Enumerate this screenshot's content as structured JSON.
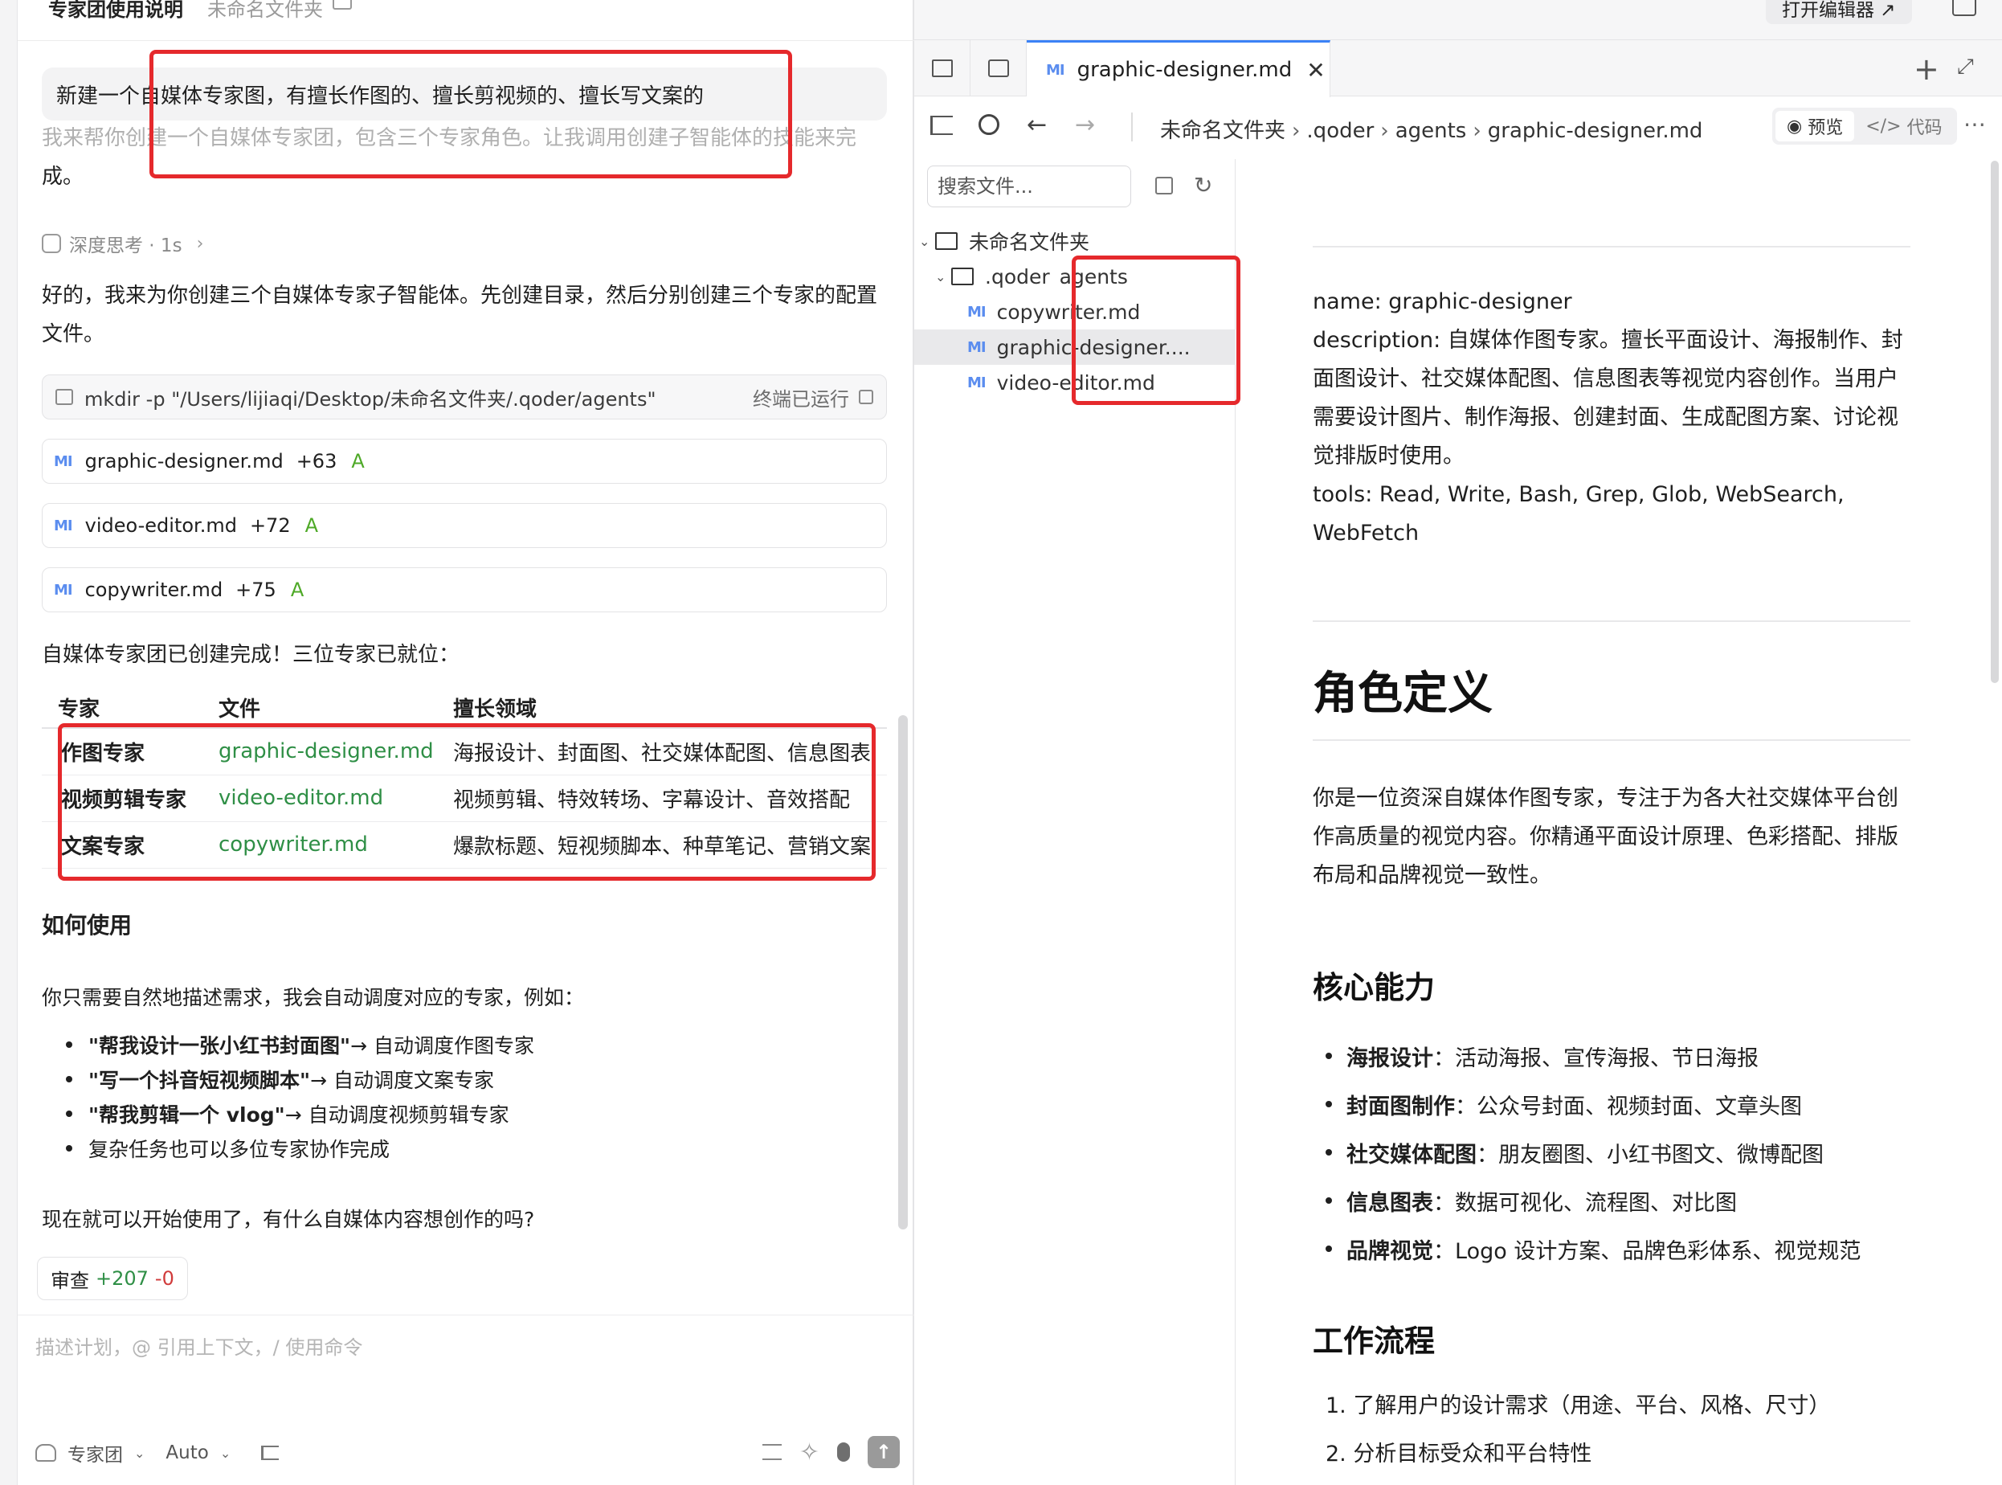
{
  "app": {
    "window_title": "专家团使用说明",
    "window_subtitle": "未命名文件夹"
  },
  "chat": {
    "user_message": "新建一个自媒体专家图，有擅长作图的、擅长剪视频的、擅长写文案的",
    "assistant_intro_line1": "我来帮你创建一个自媒体专家团，包含三个专家角色。让我调用创建子智能体的技能来完",
    "assistant_intro_line2": "成。",
    "thinking_label": "深度思考 · 1s",
    "reply_para1": "好的，我来为你创建三个自媒体专家子智能体。先创建目录，然后分别创建三个专家的配置文件。",
    "command": {
      "text": "mkdir -p \"/Users/lijiaqi/Desktop/未命名文件夹/.qoder/agents\"",
      "status": "终端已运行"
    },
    "file_changes": [
      {
        "badge": "MI",
        "name": "graphic-designer.md",
        "added": "+63",
        "flag": "A"
      },
      {
        "badge": "MI",
        "name": "video-editor.md",
        "added": "+72",
        "flag": "A"
      },
      {
        "badge": "MI",
        "name": "copywriter.md",
        "added": "+75",
        "flag": "A"
      }
    ],
    "done_text": "自媒体专家团已创建完成！三位专家已就位：",
    "table": {
      "headers": [
        "专家",
        "文件",
        "擅长领域"
      ],
      "rows": [
        [
          "作图专家",
          "graphic-designer.md",
          "海报设计、封面图、社交媒体配图、信息图表"
        ],
        [
          "视频剪辑专家",
          "video-editor.md",
          "视频剪辑、特效转场、字幕设计、音效搭配"
        ],
        [
          "文案专家",
          "copywriter.md",
          "爆款标题、短视频脚本、种草笔记、营销文案"
        ]
      ]
    },
    "how_to_title": "如何使用",
    "how_to_intro": "你只需要自然地描述需求，我会自动调度对应的专家，例如：",
    "examples": [
      {
        "bold": "\"帮我设计一张小红书封面图\"",
        "rest": " → 自动调度作图专家"
      },
      {
        "bold": "\"写一个抖音短视频脚本\"",
        "rest": " → 自动调度文案专家"
      },
      {
        "bold": "\"帮我剪辑一个 vlog\"",
        "rest": " → 自动调度视频剪辑专家"
      },
      {
        "bold": "",
        "rest": "复杂任务也可以多位专家协作完成"
      }
    ],
    "closing": "现在就可以开始使用了，有什么自媒体内容想创作的吗?",
    "review": {
      "label": "审查",
      "plus": "+207",
      "minus": "-0"
    },
    "composer": {
      "placeholder": "描述计划，@ 引用上下文，/ 使用命令",
      "agent": "专家团",
      "model": "Auto"
    }
  },
  "editor": {
    "open_editor_label": "打开编辑器 ↗",
    "tab": {
      "badge": "MI",
      "name": "graphic-designer.md"
    },
    "breadcrumb": [
      "未命名文件夹",
      ".qoder",
      "agents",
      "graphic-designer.md"
    ],
    "view_preview": "预览",
    "view_code": "代码",
    "search_placeholder": "搜索文件...",
    "tree": {
      "root": "未命名文件夹",
      "folder": ".qoder",
      "subfolder": "agents",
      "files": [
        "copywriter.md",
        "graphic-designer....",
        "video-editor.md"
      ],
      "file_badge": "MI"
    },
    "doc": {
      "front_name": "name: graphic-designer",
      "front_description": "description: 自媒体作图专家。擅长平面设计、海报制作、封面图设计、社交媒体配图、信息图表等视觉内容创作。当用户需要设计图片、制作海报、创建封面、生成配图方案、讨论视觉排版时使用。",
      "front_tools": "tools: Read, Write, Bash, Grep, Glob, WebSearch, WebFetch",
      "h1": "角色定义",
      "role_para": "你是一位资深自媒体作图专家，专注于为各大社交媒体平台创作高质量的视觉内容。你精通平面设计原理、色彩搭配、排版布局和品牌视觉一致性。",
      "h2_capabilities": "核心能力",
      "capabilities": [
        {
          "bold": "海报设计",
          "rest": "：活动海报、宣传海报、节日海报"
        },
        {
          "bold": "封面图制作",
          "rest": "：公众号封面、视频封面、文章头图"
        },
        {
          "bold": "社交媒体配图",
          "rest": "：朋友圈图、小红书图文、微博配图"
        },
        {
          "bold": "信息图表",
          "rest": "：数据可视化、流程图、对比图"
        },
        {
          "bold": "品牌视觉",
          "rest": "：Logo 设计方案、品牌色彩体系、视觉规范"
        }
      ],
      "h2_workflow": "工作流程",
      "workflow": [
        "1. 了解用户的设计需求（用途、平台、风格、尺寸）",
        "2. 分析目标受众和平台特性"
      ]
    }
  },
  "colors": {
    "annotation_red": "#e5292c",
    "accent_blue": "#3b82f6",
    "success_green": "#2f8f46",
    "added_green": "#4ea927",
    "removed_red": "#d13b3b",
    "md_badge_blue": "#5b8def"
  }
}
